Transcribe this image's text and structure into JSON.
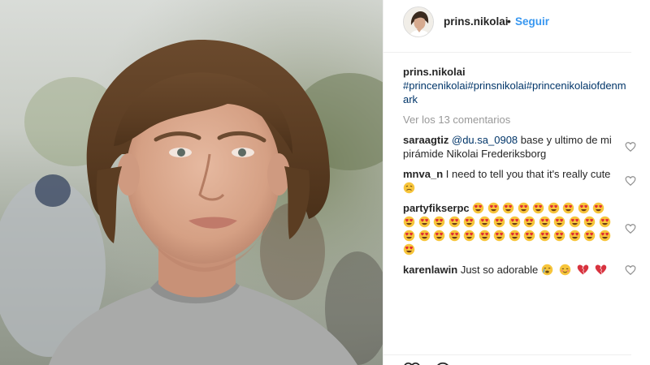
{
  "post": {
    "username": "prins.nikolai",
    "follow_label": "Seguir",
    "dot": "•"
  },
  "caption": {
    "username": "prins.nikolai",
    "hashtags": "#princenikolai#prinsnikolai#princenikolaiofdenmark"
  },
  "view_comments_label": "Ver los 13 comentarios",
  "comments": [
    {
      "user": "saraagtiz",
      "mention": "@du.sa_0908",
      "text": " base y ultimo de mi pirámide Nikolai Frederiksborg"
    },
    {
      "user": "mnva_n",
      "text": " I need to tell you that it's really cute "
    },
    {
      "user": "partyfikserpc",
      "text": ""
    },
    {
      "user": "karenlawin",
      "text": " Just so adorable "
    }
  ],
  "emoji": {
    "comment2": [
      "weary-face"
    ],
    "comment3_count": 38,
    "comment3_type": "heart-eyes-face",
    "comment4": [
      "crying-face",
      "blushing-face",
      "broken-heart",
      "broken-heart"
    ]
  },
  "colors": {
    "link": "#003569",
    "follow": "#3897f0",
    "muted": "#999999",
    "text": "#262626"
  }
}
